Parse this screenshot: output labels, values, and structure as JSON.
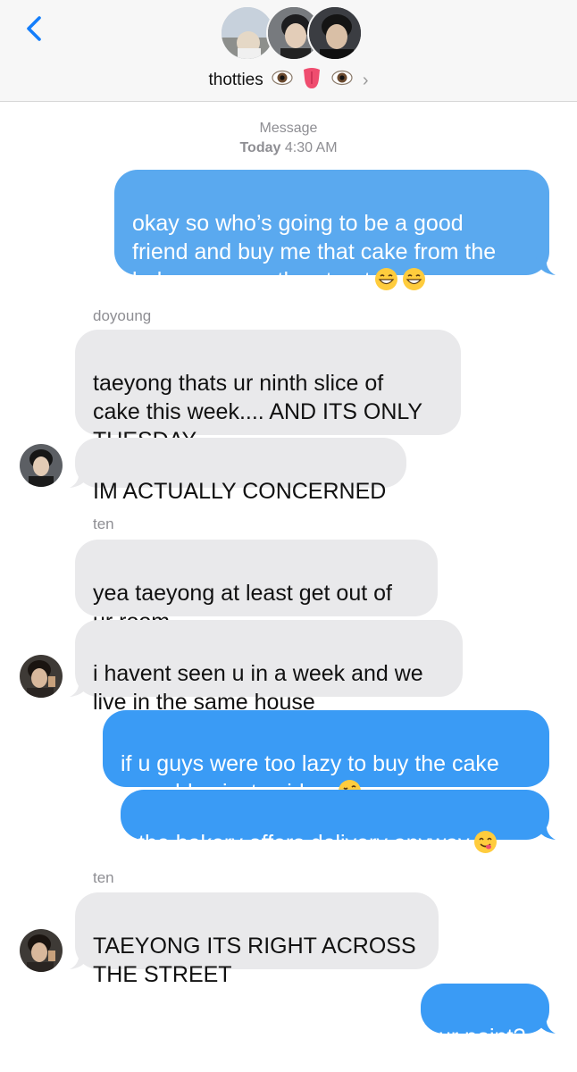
{
  "header": {
    "back_icon": "chevron-left-icon",
    "group_name": "thotties",
    "name_emojis": [
      "eye-emoji",
      "tongue-emoji",
      "eye-emoji"
    ],
    "chevron": "›"
  },
  "timestamp": {
    "service": "Message",
    "day": "Today",
    "time": "4:30 AM"
  },
  "messages": [
    {
      "from": "me",
      "text": "okay so who’s going to be a good\nfriend and buy me that cake from the\nbakery across the street"
    },
    {
      "from": "doyoung",
      "sender_label": "doyoung",
      "text": "taeyong thats ur ninth slice of\ncake this week.... AND ITS ONLY\nTUESDAY"
    },
    {
      "from": "doyoung",
      "text": "IM ACTUALLY CONCERNED"
    },
    {
      "from": "ten",
      "sender_label": "ten",
      "text": "yea taeyong at least get out of\nur room"
    },
    {
      "from": "ten",
      "text": "i havent seen u in a week and we\nlive in the same house"
    },
    {
      "from": "me",
      "text": "if u guys were too lazy to buy the cake\nu couldve just said so"
    },
    {
      "from": "me",
      "text": "the bakery offers delivery anyway"
    },
    {
      "from": "ten",
      "sender_label": "ten",
      "text": "TAEYONG ITS RIGHT ACROSS\nTHE STREET"
    },
    {
      "from": "me",
      "text": "ur point?"
    }
  ],
  "colors": {
    "sent": "#3a9bf5",
    "received": "#e9e9eb",
    "accent": "#147efb"
  }
}
